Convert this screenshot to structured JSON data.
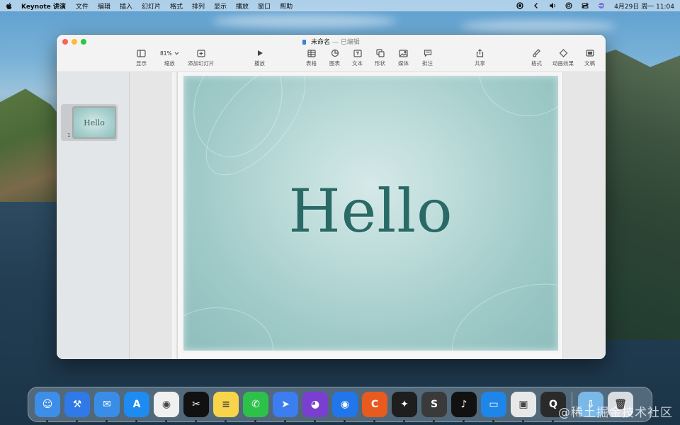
{
  "menubar": {
    "app_name": "Keynote 讲演",
    "items": [
      "文件",
      "编辑",
      "插入",
      "幻灯片",
      "格式",
      "排列",
      "显示",
      "播放",
      "窗口",
      "帮助"
    ],
    "clock": "4月29日 周一  11:04"
  },
  "window": {
    "title": "未命名",
    "subtitle": "— 已编辑"
  },
  "toolbar": {
    "view": "显示",
    "zoom_value": "81%",
    "zoom": "缩放",
    "add_slide": "添加幻灯片",
    "play": "播放",
    "table": "表格",
    "chart": "图表",
    "text": "文本",
    "shape": "形状",
    "media": "媒体",
    "comment": "批注",
    "share": "共享",
    "format": "格式",
    "animate": "动画效果",
    "document": "文稿"
  },
  "navigator": {
    "slides": [
      {
        "number": "1",
        "text": "Hello"
      }
    ]
  },
  "slide": {
    "text": "Hello"
  },
  "dock": {
    "apps": [
      {
        "icon": "finder-icon",
        "color": "#3d8ee8",
        "glyph": "☺"
      },
      {
        "icon": "xcode-icon",
        "color": "#2f7ae6",
        "glyph": "⚒"
      },
      {
        "icon": "mail-icon",
        "color": "#3a8de6",
        "glyph": "✉"
      },
      {
        "icon": "app-store-icon",
        "color": "#1e8bf0",
        "glyph": "A"
      },
      {
        "icon": "chrome-icon",
        "color": "#f0f0f0",
        "glyph": "◉"
      },
      {
        "icon": "capcut-icon",
        "color": "#111111",
        "glyph": "✂"
      },
      {
        "icon": "notes-icon",
        "color": "#f7d44a",
        "glyph": "≡"
      },
      {
        "icon": "wechat-icon",
        "color": "#2ec14a",
        "glyph": "✆"
      },
      {
        "icon": "feishu-icon",
        "color": "#3c7ef0",
        "glyph": "➤"
      },
      {
        "icon": "github-desktop-icon",
        "color": "#7a3fd1",
        "glyph": "◕"
      },
      {
        "icon": "maps-pin-icon",
        "color": "#2276ec",
        "glyph": "◉"
      },
      {
        "icon": "clion-icon",
        "color": "#e85a1e",
        "glyph": "C"
      },
      {
        "icon": "figma-icon",
        "color": "#1e1e1e",
        "glyph": "✦"
      },
      {
        "icon": "sublime-text-icon",
        "color": "#3a3a3a",
        "glyph": "S"
      },
      {
        "icon": "tiktok-icon",
        "color": "#111111",
        "glyph": "♪"
      },
      {
        "icon": "keynote-icon",
        "color": "#1d86e8",
        "glyph": "▭"
      },
      {
        "icon": "preview-icon",
        "color": "#e8e8e8",
        "glyph": "▣"
      },
      {
        "icon": "quicktime-icon",
        "color": "#2a2a2a",
        "glyph": "Q"
      }
    ],
    "trailing": [
      {
        "icon": "downloads-folder-icon",
        "color": "#7ab8e8",
        "glyph": "⇩"
      },
      {
        "icon": "trash-icon",
        "color": "#d8dde2",
        "glyph": "🗑"
      }
    ]
  },
  "watermark": "@稀土掘金技术社区"
}
